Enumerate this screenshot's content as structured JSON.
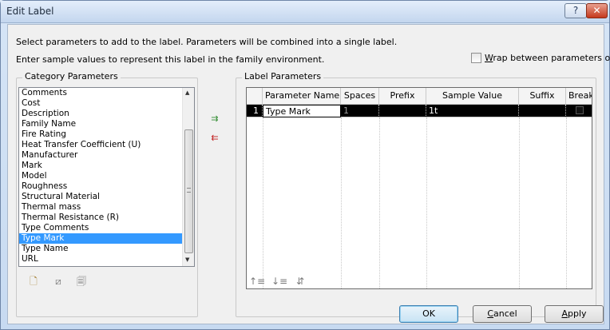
{
  "title": "Edit Label",
  "titlebar": {
    "help_glyph": "?",
    "close_glyph": "✕"
  },
  "info": {
    "line1": "Select parameters to add to the label.  Parameters will be combined into a single label.",
    "line2": "Enter sample values to represent this label in the family environment."
  },
  "wrap": {
    "prefix": "",
    "underlined": "W",
    "rest": "rap between parameters only",
    "checked": false
  },
  "category": {
    "title": "Category Parameters",
    "items": [
      "Comments",
      "Cost",
      "Description",
      "Family Name",
      "Fire Rating",
      "Heat Transfer Coefficient (U)",
      "Manufacturer",
      "Mark",
      "Model",
      "Roughness",
      "Structural Material",
      "Thermal mass",
      "Thermal Resistance (R)",
      "Type Comments",
      "Type Mark",
      "Type Name",
      "URL"
    ],
    "selected_index": 14
  },
  "label": {
    "title": "Label Parameters",
    "columns": [
      "Parameter Name",
      "Spaces",
      "Prefix",
      "Sample Value",
      "Suffix",
      "Break"
    ],
    "rows": [
      {
        "index": "1",
        "parameter_name": "Type Mark",
        "spaces": "1",
        "prefix": "",
        "sample_value": "1t",
        "suffix": "",
        "break": false
      }
    ]
  },
  "icons": {
    "new_param": "new-parameter-icon",
    "edit_param": "edit-parameter-icon",
    "add_shared": "add-shared-parameter-icon",
    "move_up": "move-up-icon",
    "move_down": "move-down-icon",
    "sort": "sort-icon",
    "add_to_label": "add-to-label-icon",
    "remove_from_label": "remove-from-label-icon"
  },
  "buttons": {
    "ok": "OK",
    "cancel_underlined": "C",
    "cancel_rest": "ancel",
    "apply_underlined": "A",
    "apply_rest": "pply"
  }
}
